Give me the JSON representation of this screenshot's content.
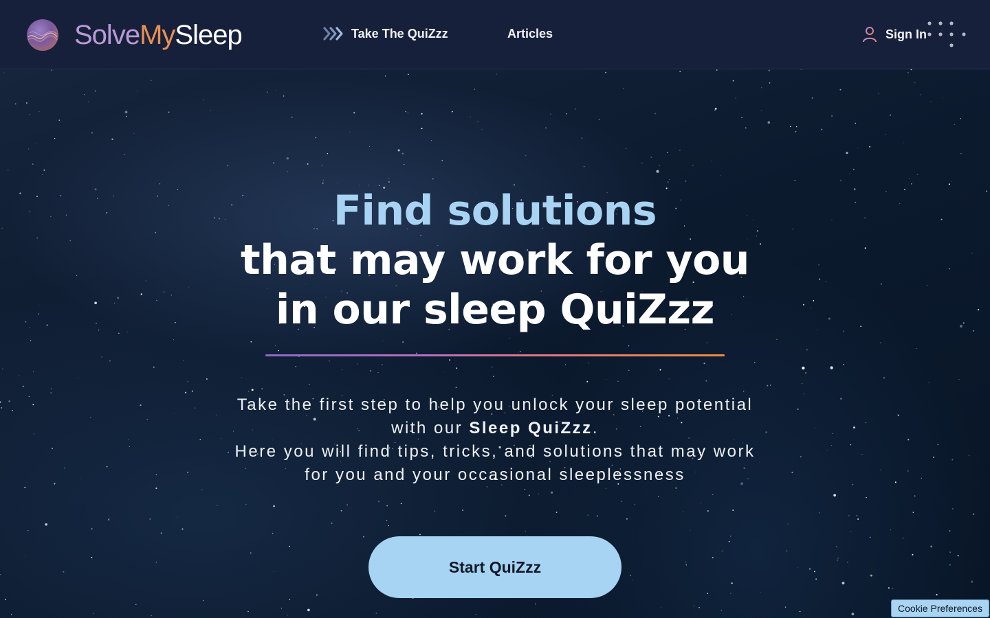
{
  "brand": {
    "word1": "Solve",
    "word2": "My",
    "word3": "Sleep"
  },
  "nav": {
    "quiz_label": "Take The QuiZzz",
    "articles_label": "Articles",
    "signin_label": "Sign In"
  },
  "hero": {
    "headline_line1": "Find solutions",
    "headline_line2": "that may work for you",
    "headline_line3": "in our sleep QuiZzz",
    "desc_part1": "Take the first step to help you unlock your sleep potential with our ",
    "desc_bold": "Sleep QuiZzz",
    "desc_part2": ".",
    "desc_line3": "Here you will find tips, tricks, and solutions that may work for you and your occasional sleeplessness",
    "cta_label": "Start QuiZzz"
  },
  "cookie": {
    "label": "Cookie Preferences"
  },
  "colors": {
    "nav_bg": "#17203a",
    "accent_blue": "#a6d4f2",
    "brand_purple": "#b99ad6",
    "brand_orange": "#e98f55"
  },
  "icons": {
    "logo": "moon-wave-logo-icon",
    "quiz": "double-chevron-icon",
    "signin": "user-icon",
    "decor": "dot-grid-icon"
  }
}
